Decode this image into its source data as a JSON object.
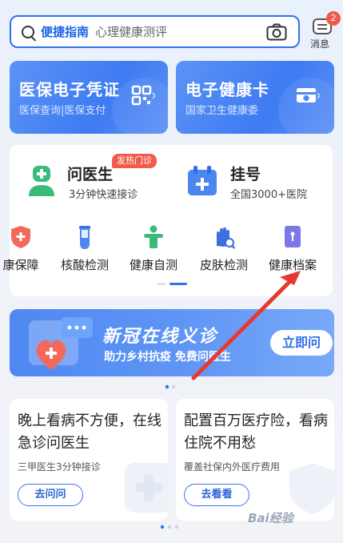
{
  "search": {
    "keyword": "便捷指南",
    "placeholder": "心理健康测评"
  },
  "messages": {
    "label": "消息",
    "count": "2"
  },
  "top_cards": [
    {
      "title": "医保电子凭证",
      "subtitle": "医保查询|医保支付",
      "icon": "qr-code-icon"
    },
    {
      "title": "电子健康卡",
      "subtitle": "国家卫生健康委",
      "icon": "health-card-icon"
    }
  ],
  "services_main": [
    {
      "title": "问医生",
      "subtitle": "3分钟快速接诊",
      "tag": "发热门诊",
      "icon": "doctor-icon"
    },
    {
      "title": "挂号",
      "subtitle": "全国3000+医院",
      "icon": "calendar-icon"
    }
  ],
  "service_items": [
    {
      "label": "康保障",
      "icon": "shield-icon"
    },
    {
      "label": "核酸检测",
      "icon": "test-tube-icon"
    },
    {
      "label": "健康自测",
      "icon": "person-icon"
    },
    {
      "label": "皮肤检测",
      "icon": "hand-scan-icon"
    },
    {
      "label": "健康档案",
      "icon": "file-icon"
    }
  ],
  "banner": {
    "headline": "新冠在线义诊",
    "subline": "助力乡村抗疫 免费问医生",
    "button": "立即问"
  },
  "promo_cards": [
    {
      "title": "晚上看病不方便，在线急诊问医生",
      "subtitle": "三甲医生3分钟接诊",
      "button": "去问问"
    },
    {
      "title": "配置百万医疗险，看病住院不用愁",
      "subtitle": "覆盖社保内外医疗费用",
      "button": "去看看"
    }
  ],
  "watermark": "Bai经验",
  "colors": {
    "primary": "#2d73ec",
    "accent_red": "#f25b4b",
    "annotation_arrow": "#e8392f"
  }
}
